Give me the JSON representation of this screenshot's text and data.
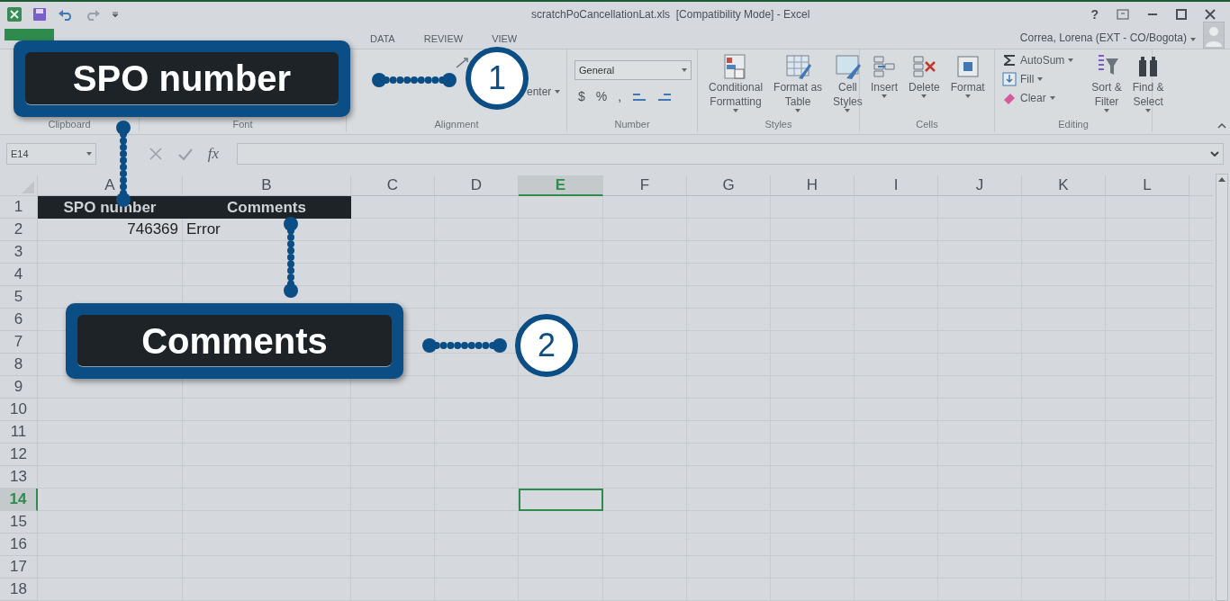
{
  "window": {
    "title": "scratchPoCancellationLat.xls  [Compatibility Mode] - Excel",
    "user": "Correa, Lorena (EXT - CO/Bogota)",
    "help": "?"
  },
  "ribbon_tabs": [
    {
      "label": "DATA",
      "selected": false
    },
    {
      "label": "REVIEW",
      "selected": false
    },
    {
      "label": "VIEW",
      "selected": false
    }
  ],
  "ribbon": {
    "groups": [
      {
        "label": "Clipboard"
      },
      {
        "label": "Font"
      },
      {
        "label": "Alignment",
        "merge_label": "enter"
      },
      {
        "label": "Number",
        "number_format": "General",
        "symbols": [
          "$",
          "%",
          ","
        ]
      },
      {
        "label": "Styles",
        "buttons": [
          {
            "lines": [
              "Conditional",
              "Formatting"
            ]
          },
          {
            "lines": [
              "Format as",
              "Table"
            ]
          },
          {
            "lines": [
              "Cell",
              "Styles"
            ]
          }
        ]
      },
      {
        "label": "Cells",
        "buttons": [
          {
            "lines": [
              "Insert"
            ]
          },
          {
            "lines": [
              "Delete"
            ]
          },
          {
            "lines": [
              "Format"
            ]
          }
        ]
      },
      {
        "label": "Editing",
        "small_buttons": [
          "AutoSum",
          "Fill",
          "Clear"
        ],
        "buttons": [
          {
            "lines": [
              "Sort &",
              "Filter"
            ]
          },
          {
            "lines": [
              "Find &",
              "Select"
            ]
          }
        ]
      }
    ]
  },
  "formula_bar": {
    "name_box": "E14",
    "function_label": "fx"
  },
  "sheet": {
    "columns": [
      {
        "label": "A",
        "selected": false
      },
      {
        "label": "B",
        "selected": false
      },
      {
        "label": "C",
        "selected": false
      },
      {
        "label": "D",
        "selected": false
      },
      {
        "label": "E",
        "selected": true
      },
      {
        "label": "F",
        "selected": false
      },
      {
        "label": "G",
        "selected": false
      },
      {
        "label": "H",
        "selected": false
      },
      {
        "label": "I",
        "selected": false
      },
      {
        "label": "J",
        "selected": false
      },
      {
        "label": "K",
        "selected": false
      },
      {
        "label": "L",
        "selected": false
      }
    ],
    "rows": [
      {
        "label": "1",
        "selected": false,
        "cells": [
          {
            "text": "SPO number",
            "kind": "header"
          },
          {
            "text": "Comments",
            "kind": "header"
          }
        ]
      },
      {
        "label": "2",
        "selected": false,
        "cells": [
          {
            "text": "746369",
            "kind": "number"
          },
          {
            "text": "Error",
            "kind": "text"
          }
        ]
      },
      {
        "label": "3",
        "selected": false
      },
      {
        "label": "4",
        "selected": false
      },
      {
        "label": "5",
        "selected": false
      },
      {
        "label": "6",
        "selected": false
      },
      {
        "label": "7",
        "selected": false
      },
      {
        "label": "8",
        "selected": false
      },
      {
        "label": "9",
        "selected": false
      },
      {
        "label": "10",
        "selected": false
      },
      {
        "label": "11",
        "selected": false
      },
      {
        "label": "12",
        "selected": false
      },
      {
        "label": "13",
        "selected": false
      },
      {
        "label": "14",
        "selected": true
      },
      {
        "label": "15",
        "selected": false
      },
      {
        "label": "16",
        "selected": false
      },
      {
        "label": "17",
        "selected": false
      },
      {
        "label": "18",
        "selected": false
      }
    ]
  },
  "callouts": [
    {
      "label": "SPO number",
      "number": "1"
    },
    {
      "label": "Comments",
      "number": "2"
    }
  ]
}
